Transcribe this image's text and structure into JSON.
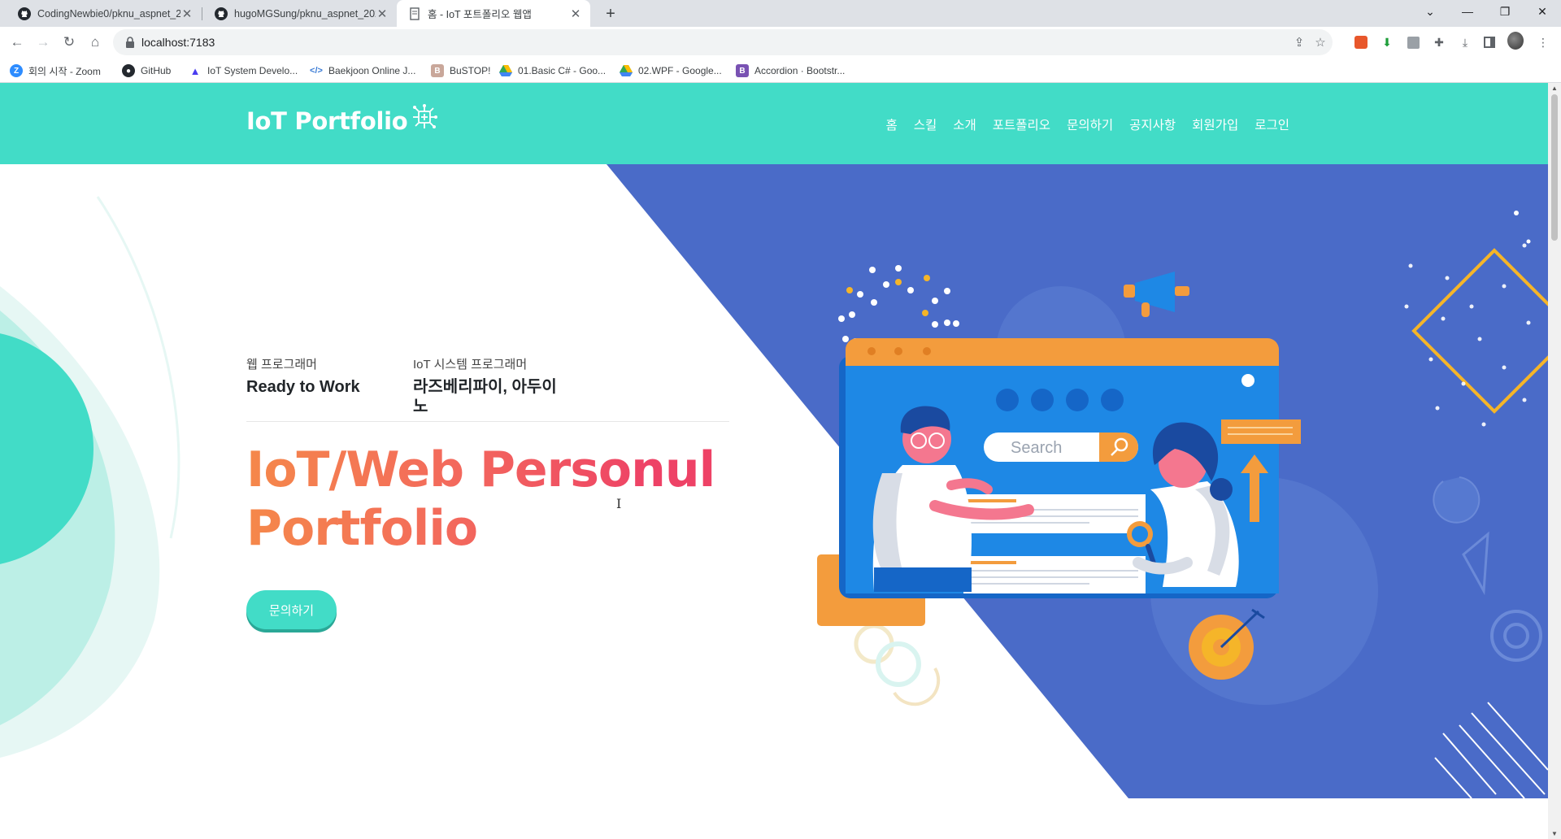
{
  "browser": {
    "tabs": [
      {
        "title": "CodingNewbie0/pknu_aspnet_2",
        "icon": "github-icon",
        "active": false
      },
      {
        "title": "hugoMGSung/pknu_aspnet_202",
        "icon": "github-icon",
        "active": false
      },
      {
        "title": "홈 - IoT 포트폴리오 웹앱",
        "icon": "page-icon",
        "active": true
      }
    ],
    "url": "localhost:7183",
    "bookmarks": [
      {
        "label": "회의 시작 - Zoom",
        "icon": "zoom-icon",
        "color": "#2d8cff"
      },
      {
        "label": "GitHub",
        "icon": "github-icon",
        "color": "#24292f"
      },
      {
        "label": "IoT System Develo...",
        "icon": "triangle-icon",
        "color": "#4a3df0"
      },
      {
        "label": "Baekjoon Online J...",
        "icon": "code-icon",
        "color": "#3a7bd5"
      },
      {
        "label": "BuSTOP!",
        "icon": "bus-icon",
        "color": "#8a6a5a"
      },
      {
        "label": "01.Basic C# - Goo...",
        "icon": "drive-icon",
        "color": "#f4b400"
      },
      {
        "label": "02.WPF - Google...",
        "icon": "drive-icon",
        "color": "#f4b400"
      },
      {
        "label": "Accordion · Bootstr...",
        "icon": "bootstrap-icon",
        "color": "#7952b3"
      }
    ]
  },
  "site": {
    "brand": "IoT Portfolio",
    "nav": [
      "홈",
      "스킬",
      "소개",
      "포트폴리오",
      "문의하기",
      "공지사항",
      "회원가입",
      "로그인"
    ],
    "stats": [
      {
        "role": "웹 프로그래머",
        "value": "Ready to Work"
      },
      {
        "role": "IoT 시스템 프로그래머",
        "value": "라즈베리파이, 아두이노"
      }
    ],
    "hero_title": "IoT/Web Personul Portfolio",
    "cta": "문의하기",
    "illustration": {
      "search_placeholder": "Search"
    }
  },
  "colors": {
    "accent": "#42dcc7",
    "hero_blue": "#4a6bc8",
    "title_gradient_start": "#f5884a",
    "title_gradient_end": "#ee4266"
  }
}
